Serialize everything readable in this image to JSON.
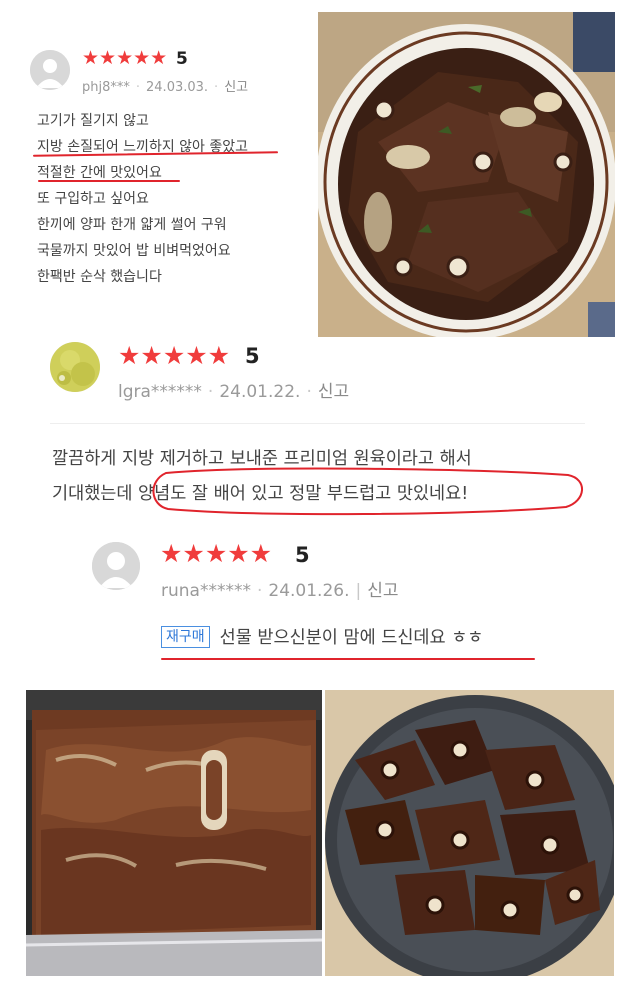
{
  "reviews": [
    {
      "stars": "★★★★★",
      "score": "5",
      "user": "phj8***",
      "date": "24.03.03.",
      "report": "신고",
      "lines": [
        "고기가 질기지 않고",
        "지방 손질되어 느끼하지 않아 좋았고",
        "적절한 간에 맛있어요",
        "또 구입하고 싶어요",
        "한끼에 양파 한개 얇게 썰어 구워",
        "국물까지 맛있어 밥 비벼먹었어요",
        "한팩반 순삭 했습니다"
      ]
    },
    {
      "stars": "★★★★★",
      "score": "5",
      "user": "lgra******",
      "date": "24.01.22.",
      "report": "신고",
      "lines": [
        "깔끔하게 지방 제거하고 보내준 프리미엄 원육이라고 해서",
        "기대했는데 양념도 잘 배어 있고 정말 부드럽고 맛있네요!"
      ]
    },
    {
      "stars": "★★★★★",
      "score": "5",
      "user": "runa******",
      "date": "24.01.26.",
      "report": "신고",
      "tag": "재구매",
      "text": "선물 받으신분이 맘에 드신데요 ㅎㅎ"
    }
  ],
  "photos": {
    "photo1": "galbi-bowl-photo",
    "photo2": "raw-marinated-galbi-photo",
    "photo3": "grilled-galbi-stone-plate-photo"
  },
  "colors": {
    "star": "#f03c3c",
    "underline": "#e0242c",
    "tag": "#2f78d8"
  }
}
